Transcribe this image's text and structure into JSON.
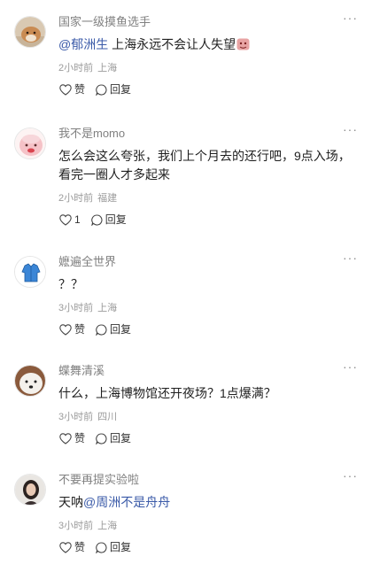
{
  "comments": [
    {
      "username": "国家一级摸鱼选手",
      "mention": "@郁洲生",
      "text": " 上海永远不会让人失望",
      "emoji": "face-emoji",
      "time": "2小时前",
      "location": "上海",
      "like_label": "赞",
      "reply_label": "回复",
      "avatar": "dog-photo"
    },
    {
      "username": "我不是momo",
      "text": "怎么会这么夸张，我们上个月去的还行吧，9点入场，看完一圈人才多起来",
      "time": "2小时前",
      "location": "福建",
      "like_label": "1",
      "reply_label": "回复",
      "avatar": "pink-character"
    },
    {
      "username": "嬷遍全世界",
      "text": "？？",
      "time": "3小时前",
      "location": "上海",
      "like_label": "赞",
      "reply_label": "回复",
      "avatar": "blue-jacket"
    },
    {
      "username": "蝶舞清溪",
      "text": "什么，上海博物馆还开夜场？1点爆满？",
      "time": "3小时前",
      "location": "四川",
      "like_label": "赞",
      "reply_label": "回复",
      "avatar": "white-dog"
    },
    {
      "username": "不要再提实验啦",
      "prefix": "天呐",
      "mention": "@周洲不是舟舟",
      "time": "3小时前",
      "location": "上海",
      "like_label": "赞",
      "reply_label": "回复",
      "avatar": "girl-photo"
    }
  ],
  "more_icon": "more-dots-icon",
  "like_icon": "heart-icon",
  "reply_icon": "speech-bubble-icon",
  "colors": {
    "mention": "#3a5aa8",
    "meta": "#9a9a9a",
    "name": "#808080"
  }
}
